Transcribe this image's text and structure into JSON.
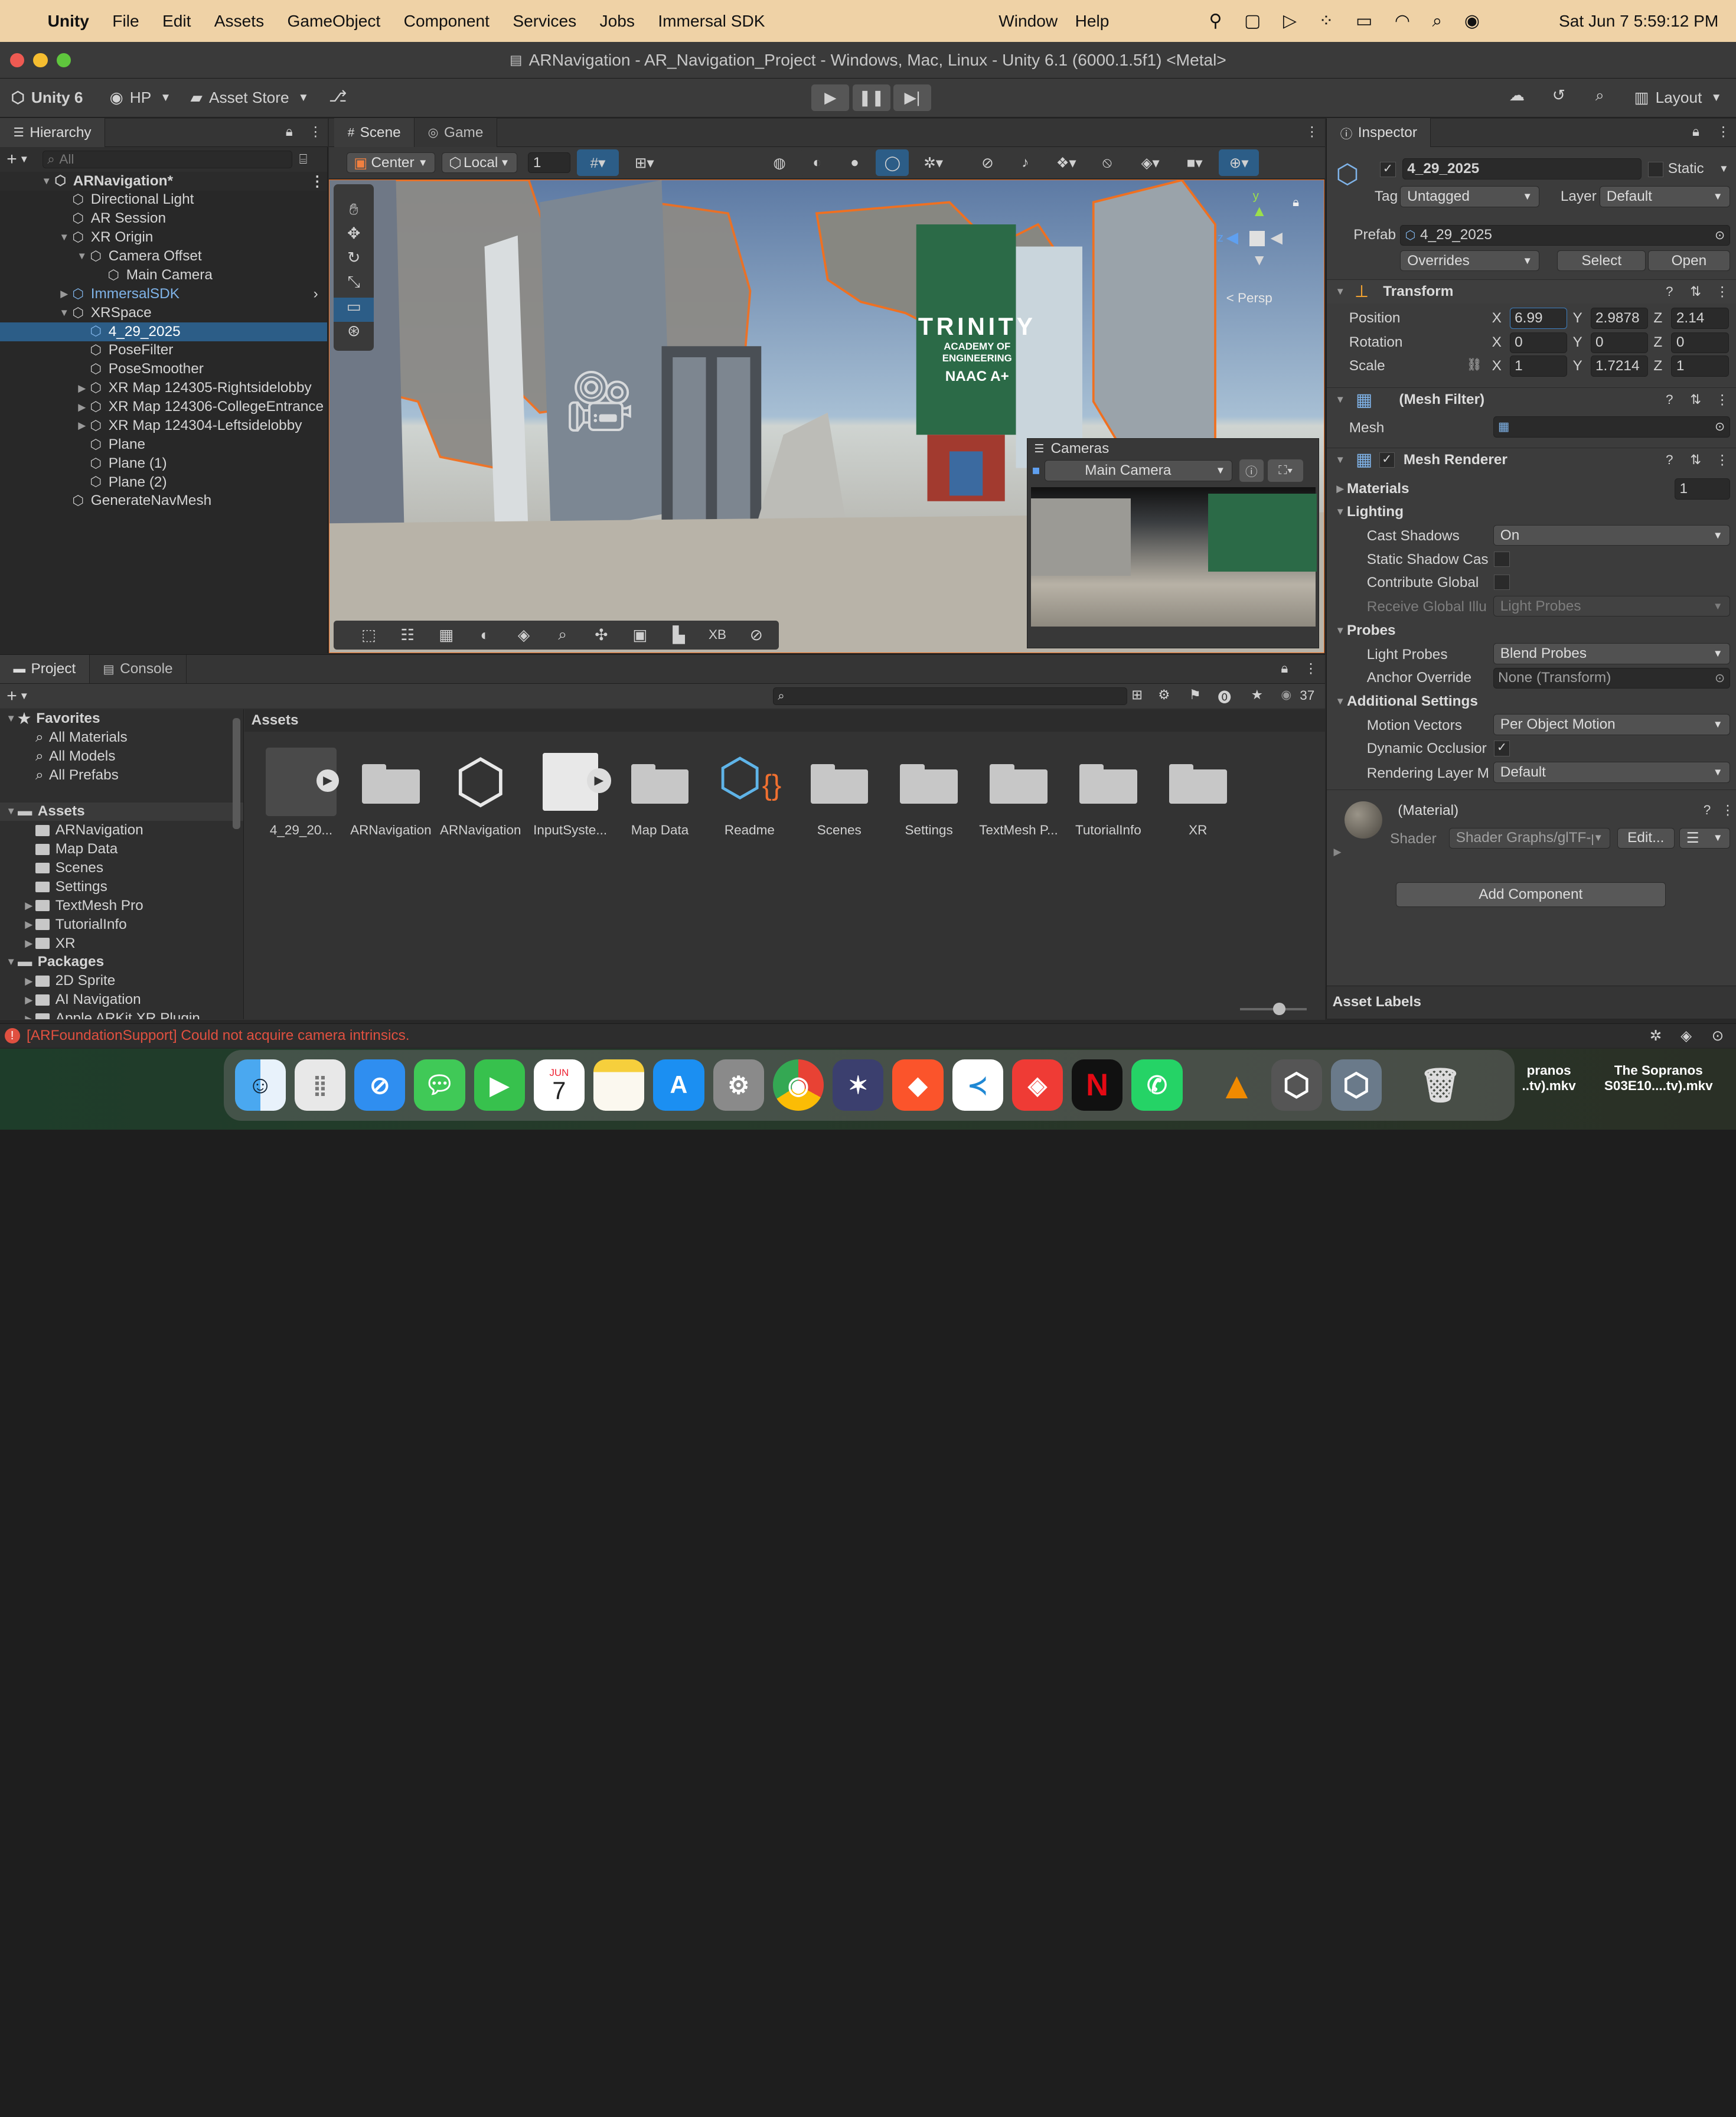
{
  "menubar": {
    "app": "Unity",
    "items": [
      "File",
      "Edit",
      "Assets",
      "GameObject",
      "Component",
      "Services",
      "Jobs",
      "Immersal SDK"
    ],
    "right_items": [
      "Window",
      "Help"
    ],
    "clock": "Sat Jun 7  5:59:12 PM"
  },
  "window": {
    "title": "ARNavigation - AR_Navigation_Project - Windows, Mac, Linux - Unity 6.1 (6000.1.5f1) <Metal>"
  },
  "toolbar": {
    "unity_label": "Unity 6",
    "account": "HP",
    "asset_store": "Asset Store",
    "layout": "Layout"
  },
  "hierarchy": {
    "tab": "Hierarchy",
    "search_placeholder": "All",
    "scene": "ARNavigation*",
    "items": [
      {
        "label": "Directional Light",
        "depth": 1,
        "arrow": ""
      },
      {
        "label": "AR Session",
        "depth": 1,
        "arrow": ""
      },
      {
        "label": "XR Origin",
        "depth": 1,
        "arrow": "down"
      },
      {
        "label": "Camera Offset",
        "depth": 2,
        "arrow": "down"
      },
      {
        "label": "Main Camera",
        "depth": 3,
        "arrow": ""
      },
      {
        "label": "ImmersalSDK",
        "depth": 1,
        "arrow": "right",
        "prefab": true
      },
      {
        "label": "XRSpace",
        "depth": 1,
        "arrow": "down"
      },
      {
        "label": "4_29_2025",
        "depth": 2,
        "arrow": "",
        "selected": true
      },
      {
        "label": "PoseFilter",
        "depth": 2,
        "arrow": ""
      },
      {
        "label": "PoseSmoother",
        "depth": 2,
        "arrow": ""
      },
      {
        "label": "XR Map 124305-Rightsidelobby",
        "depth": 2,
        "arrow": "right"
      },
      {
        "label": "XR Map 124306-CollegeEntrance",
        "depth": 2,
        "arrow": "right"
      },
      {
        "label": "XR Map 124304-Leftsidelobby",
        "depth": 2,
        "arrow": "right"
      },
      {
        "label": "Plane",
        "depth": 2,
        "arrow": ""
      },
      {
        "label": "Plane (1)",
        "depth": 2,
        "arrow": ""
      },
      {
        "label": "Plane (2)",
        "depth": 2,
        "arrow": ""
      },
      {
        "label": "GenerateNavMesh",
        "depth": 1,
        "arrow": ""
      }
    ]
  },
  "scene_view": {
    "tabs": [
      "Scene",
      "Game"
    ],
    "pivot": "Center",
    "space": "Local",
    "grid_value": "1",
    "persp_label": "< Persp",
    "gizmo_y": "y",
    "gizmo_z": "z",
    "sign_text": "TRINITY",
    "sign_sub": "ACADEMY OF ENGINEERING",
    "sign_naac": "NAAC A+",
    "cameras_overlay": {
      "title": "Cameras",
      "selected": "Main Camera"
    },
    "bottom_xb": "XB"
  },
  "inspector": {
    "tab": "Inspector",
    "object_name": "4_29_2025",
    "static_label": "Static",
    "tag_label": "Tag",
    "tag_value": "Untagged",
    "layer_label": "Layer",
    "layer_value": "Default",
    "prefab_label": "Prefab",
    "prefab_value": "4_29_2025",
    "overrides": "Overrides",
    "select": "Select",
    "open": "Open",
    "transform": {
      "title": "Transform",
      "position_label": "Position",
      "rotation_label": "Rotation",
      "scale_label": "Scale",
      "position": {
        "x": "6.99",
        "y": "2.9878",
        "z": "2.14"
      },
      "rotation": {
        "x": "0",
        "y": "0",
        "z": "0"
      },
      "scale": {
        "x": "1",
        "y": "1.7214",
        "z": "1"
      }
    },
    "mesh_filter": {
      "title": "(Mesh Filter)",
      "mesh_label": "Mesh"
    },
    "mesh_renderer": {
      "title": "Mesh Renderer",
      "materials_label": "Materials",
      "materials_count": "1",
      "lighting": "Lighting",
      "cast_shadows_label": "Cast Shadows",
      "cast_shadows": "On",
      "static_shadow_label": "Static Shadow Cas",
      "contribute_gi_label": "Contribute Global",
      "receive_gi_label": "Receive Global Illu",
      "receive_gi": "Light Probes",
      "probes": "Probes",
      "light_probes_label": "Light Probes",
      "light_probes": "Blend Probes",
      "anchor_label": "Anchor Override",
      "anchor": "None (Transform)",
      "additional": "Additional Settings",
      "motion_label": "Motion Vectors",
      "motion": "Per Object Motion",
      "dynamic_label": "Dynamic Occlusior",
      "render_layer_label": "Rendering Layer M",
      "render_layer": "Default"
    },
    "material": {
      "title": "(Material)",
      "shader_label": "Shader",
      "shader": "Shader Graphs/glTF-p",
      "edit": "Edit..."
    },
    "add_component": "Add Component",
    "asset_labels": "Asset Labels"
  },
  "project": {
    "tabs": [
      "Project",
      "Console"
    ],
    "count": "37",
    "favorites": "Favorites",
    "favorite_items": [
      "All Materials",
      "All Models",
      "All Prefabs"
    ],
    "assets_root": "Assets",
    "asset_folders": [
      "ARNavigation",
      "Map Data",
      "Scenes",
      "Settings",
      "TextMesh Pro",
      "TutorialInfo",
      "XR"
    ],
    "packages": "Packages",
    "package_items": [
      "2D Sprite",
      "AI Navigation",
      "Apple ARKit XR Plugin"
    ],
    "breadcrumb": "Assets",
    "grid": [
      {
        "label": "4_29_20...",
        "kind": "model"
      },
      {
        "label": "ARNavigation",
        "kind": "folder"
      },
      {
        "label": "ARNavigation",
        "kind": "unity"
      },
      {
        "label": "InputSyste...",
        "kind": "input"
      },
      {
        "label": "Map Data",
        "kind": "folder"
      },
      {
        "label": "Readme",
        "kind": "readme"
      },
      {
        "label": "Scenes",
        "kind": "folder"
      },
      {
        "label": "Settings",
        "kind": "folder"
      },
      {
        "label": "TextMesh P...",
        "kind": "folder"
      },
      {
        "label": "TutorialInfo",
        "kind": "folder"
      },
      {
        "label": "XR",
        "kind": "folder"
      }
    ]
  },
  "status": {
    "error": "[ARFoundationSupport] Could not acquire camera intrinsics."
  },
  "dock": {
    "apps": [
      "finder-icon",
      "launchpad-icon",
      "safari-icon",
      "messages-icon",
      "facetime-icon",
      "calendar-icon",
      "notes-icon",
      "app-store-icon",
      "settings-icon",
      "chrome-icon",
      "affinity-icon",
      "brave-icon",
      "vscode-icon",
      "anydesk-icon",
      "netflix-icon",
      "whatsapp-icon",
      "vlc-icon",
      "unity-hub-icon",
      "unity6-icon",
      "trash-icon"
    ],
    "calendar_month": "JUN",
    "calendar_day": "7",
    "recent1_line1": "pranos",
    "recent1_line2": "..tv).mkv",
    "recent2_line1": "The Sopranos",
    "recent2_line2": "S03E10....tv).mkv"
  },
  "colors": {
    "accent": "#2c5d87",
    "selection": "#2c5d87",
    "orange_outline": "#f07020",
    "error": "#e05040"
  }
}
